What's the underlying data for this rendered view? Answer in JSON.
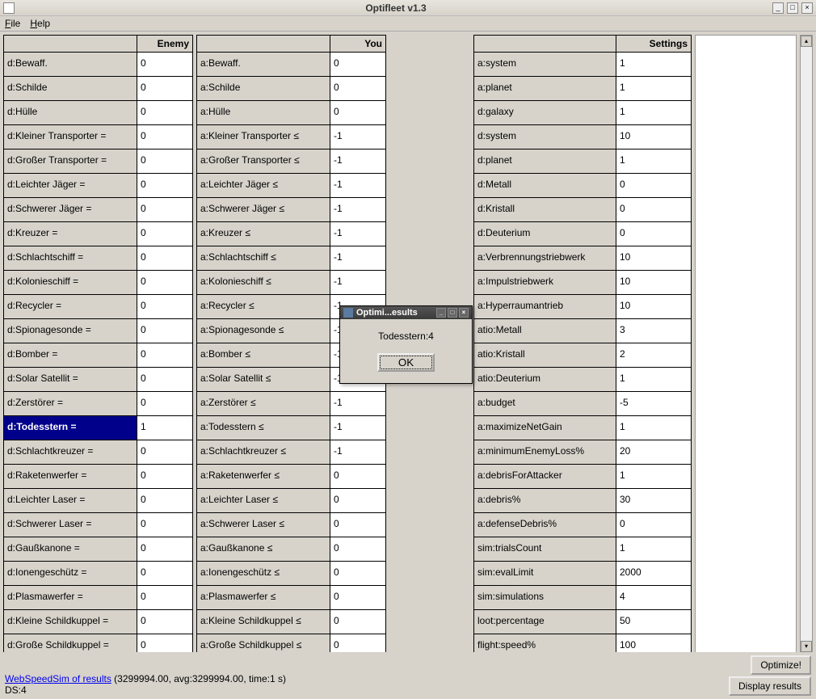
{
  "window": {
    "title": "Optifleet v1.3"
  },
  "menu": {
    "file": "File",
    "help": "Help"
  },
  "headers": {
    "enemy": "Enemy",
    "you": "You",
    "settings": "Settings"
  },
  "enemy": [
    {
      "label": "d:Bewaff.",
      "value": "0",
      "selected": false
    },
    {
      "label": "d:Schilde",
      "value": "0",
      "selected": false
    },
    {
      "label": "d:Hülle",
      "value": "0",
      "selected": false
    },
    {
      "label": "d:Kleiner Transporter =",
      "value": "0",
      "selected": false
    },
    {
      "label": "d:Großer Transporter =",
      "value": "0",
      "selected": false
    },
    {
      "label": "d:Leichter Jäger =",
      "value": "0",
      "selected": false
    },
    {
      "label": "d:Schwerer Jäger =",
      "value": "0",
      "selected": false
    },
    {
      "label": "d:Kreuzer =",
      "value": "0",
      "selected": false
    },
    {
      "label": "d:Schlachtschiff =",
      "value": "0",
      "selected": false
    },
    {
      "label": "d:Kolonieschiff =",
      "value": "0",
      "selected": false
    },
    {
      "label": "d:Recycler =",
      "value": "0",
      "selected": false
    },
    {
      "label": "d:Spionagesonde =",
      "value": "0",
      "selected": false
    },
    {
      "label": "d:Bomber =",
      "value": "0",
      "selected": false
    },
    {
      "label": "d:Solar Satellit =",
      "value": "0",
      "selected": false
    },
    {
      "label": "d:Zerstörer =",
      "value": "0",
      "selected": false
    },
    {
      "label": "d:Todesstern =",
      "value": "1",
      "selected": true
    },
    {
      "label": "d:Schlachtkreuzer =",
      "value": "0",
      "selected": false
    },
    {
      "label": "d:Raketenwerfer =",
      "value": "0",
      "selected": false
    },
    {
      "label": "d:Leichter Laser =",
      "value": "0",
      "selected": false
    },
    {
      "label": "d:Schwerer Laser =",
      "value": "0",
      "selected": false
    },
    {
      "label": "d:Gaußkanone =",
      "value": "0",
      "selected": false
    },
    {
      "label": "d:Ionengeschütz =",
      "value": "0",
      "selected": false
    },
    {
      "label": "d:Plasmawerfer =",
      "value": "0",
      "selected": false
    },
    {
      "label": "d:Kleine Schildkuppel =",
      "value": "0",
      "selected": false
    },
    {
      "label": "d:Große Schildkuppel =",
      "value": "0",
      "selected": false
    }
  ],
  "you": [
    {
      "label": "a:Bewaff.",
      "value": "0"
    },
    {
      "label": "a:Schilde",
      "value": "0"
    },
    {
      "label": "a:Hülle",
      "value": "0"
    },
    {
      "label": "a:Kleiner Transporter ≤",
      "value": "-1"
    },
    {
      "label": "a:Großer Transporter ≤",
      "value": "-1"
    },
    {
      "label": "a:Leichter Jäger ≤",
      "value": "-1"
    },
    {
      "label": "a:Schwerer Jäger ≤",
      "value": "-1"
    },
    {
      "label": "a:Kreuzer ≤",
      "value": "-1"
    },
    {
      "label": "a:Schlachtschiff ≤",
      "value": "-1"
    },
    {
      "label": "a:Kolonieschiff ≤",
      "value": "-1"
    },
    {
      "label": "a:Recycler ≤",
      "value": "-1"
    },
    {
      "label": "a:Spionagesonde ≤",
      "value": "-1"
    },
    {
      "label": "a:Bomber ≤",
      "value": "-1"
    },
    {
      "label": "a:Solar Satellit ≤",
      "value": "-1"
    },
    {
      "label": "a:Zerstörer ≤",
      "value": "-1"
    },
    {
      "label": "a:Todesstern ≤",
      "value": "-1"
    },
    {
      "label": "a:Schlachtkreuzer ≤",
      "value": "-1"
    },
    {
      "label": "a:Raketenwerfer ≤",
      "value": "0"
    },
    {
      "label": "a:Leichter Laser ≤",
      "value": "0"
    },
    {
      "label": "a:Schwerer Laser ≤",
      "value": "0"
    },
    {
      "label": "a:Gaußkanone ≤",
      "value": "0"
    },
    {
      "label": "a:Ionengeschütz ≤",
      "value": "0"
    },
    {
      "label": "a:Plasmawerfer ≤",
      "value": "0"
    },
    {
      "label": "a:Kleine Schildkuppel ≤",
      "value": "0"
    },
    {
      "label": "a:Große Schildkuppel ≤",
      "value": "0"
    }
  ],
  "settings": [
    {
      "label": "a:system",
      "value": "1"
    },
    {
      "label": "a:planet",
      "value": "1"
    },
    {
      "label": "d:galaxy",
      "value": "1"
    },
    {
      "label": "d:system",
      "value": "10"
    },
    {
      "label": "d:planet",
      "value": "1"
    },
    {
      "label": "d:Metall",
      "value": "0"
    },
    {
      "label": "d:Kristall",
      "value": "0"
    },
    {
      "label": "d:Deuterium",
      "value": "0"
    },
    {
      "label": "a:Verbrennungstriebwerk",
      "value": "10"
    },
    {
      "label": "a:Impulstriebwerk",
      "value": "10"
    },
    {
      "label": "a:Hyperraumantrieb",
      "value": "10"
    },
    {
      "label": "atio:Metall",
      "value": "3"
    },
    {
      "label": "atio:Kristall",
      "value": "2"
    },
    {
      "label": "atio:Deuterium",
      "value": "1"
    },
    {
      "label": "a:budget",
      "value": "-5"
    },
    {
      "label": "a:maximizeNetGain",
      "value": "1"
    },
    {
      "label": "a:minimumEnemyLoss%",
      "value": "20"
    },
    {
      "label": "a:debrisForAttacker",
      "value": "1"
    },
    {
      "label": "a:debris%",
      "value": "30"
    },
    {
      "label": "a:defenseDebris%",
      "value": "0"
    },
    {
      "label": "sim:trialsCount",
      "value": "1"
    },
    {
      "label": "sim:evalLimit",
      "value": "2000"
    },
    {
      "label": "sim:simulations",
      "value": "4"
    },
    {
      "label": "loot:percentage",
      "value": "50"
    },
    {
      "label": "flight:speed%",
      "value": "100"
    }
  ],
  "dialog": {
    "title": "Optimi...esults",
    "body": "Todesstern:4",
    "ok": "OK"
  },
  "footer": {
    "linkText": "WebSpeedSim of results",
    "linkSuffix": " (3299994.00, avg:3299994.00, time:1 s)",
    "ds": "DS:4",
    "optimize": "Optimize!",
    "display": "Display results"
  }
}
